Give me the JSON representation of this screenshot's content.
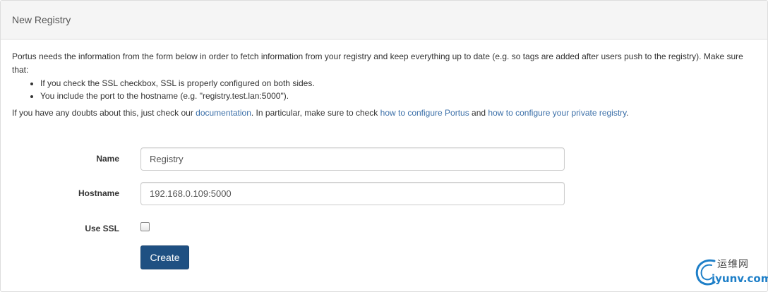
{
  "panel": {
    "title": "New Registry"
  },
  "intro": {
    "text": "Portus needs the information from the form below in order to fetch information from your registry and keep everything up to date (e.g. so tags are added after users push to the registry). Make sure that:",
    "requirements": [
      "If you check the SSL checkbox, SSL is properly configured on both sides.",
      "You include the port to the hostname (e.g. \"registry.test.lan:5000\")."
    ],
    "doubts_prefix": "If you have any doubts about this, just check our ",
    "doc_link": "documentation",
    "doubts_middle": ". In particular, make sure to check ",
    "portus_link": "how to configure Portus",
    "doubts_and": " and ",
    "registry_link": "how to configure your private registry",
    "doubts_suffix": "."
  },
  "form": {
    "name_label": "Name",
    "name_value": "Registry",
    "hostname_label": "Hostname",
    "hostname_value": "192.168.0.109:5000",
    "ssl_label": "Use SSL",
    "ssl_checked": false,
    "submit_label": "Create"
  },
  "watermark": {
    "icon": "swirl-logo-icon",
    "cn_text": "运维网",
    "url_text": "iyunv.com"
  },
  "colors": {
    "link": "#3b6fa8",
    "button": "#1f5082",
    "heading_bg": "#f5f5f5"
  }
}
